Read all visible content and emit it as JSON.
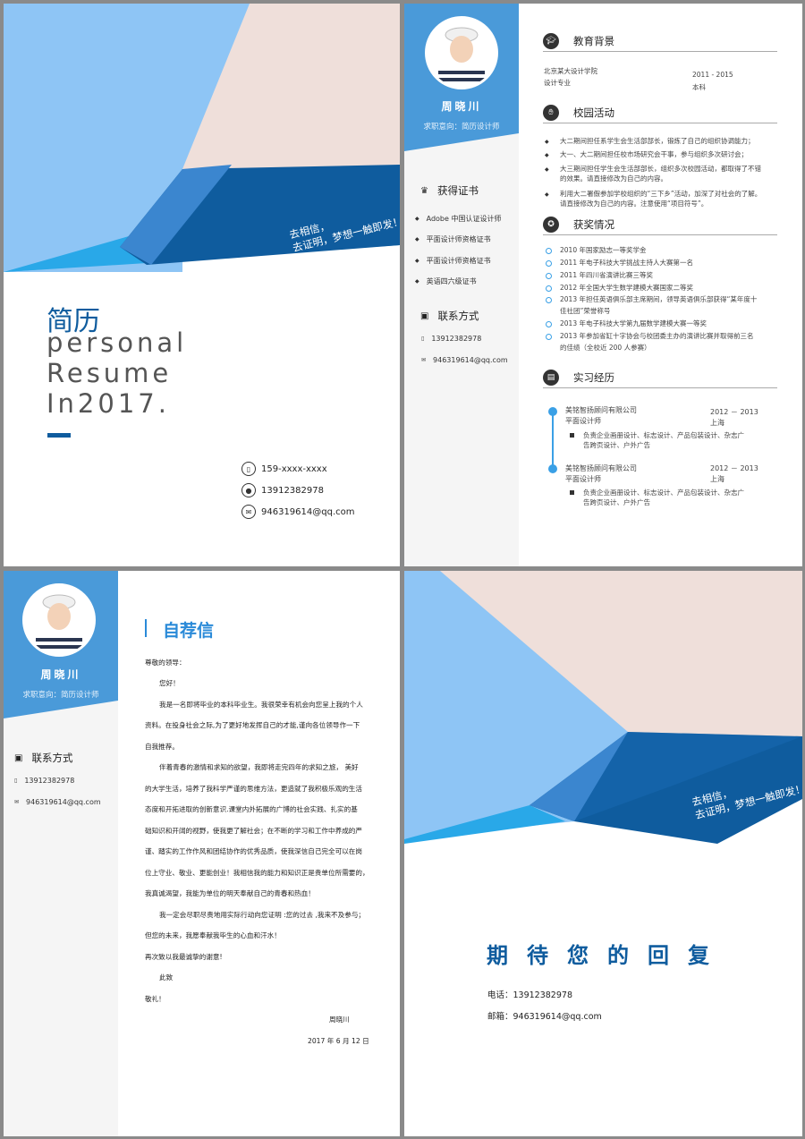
{
  "colors": {
    "navy": "#0f5c9e",
    "light_blue": "#8ec5f5",
    "mid_blue": "#4a9ad9",
    "pink": "#efdfda",
    "accent": "#2a8ad8"
  },
  "cover": {
    "slogan_line1": "去相信，",
    "slogan_line2": "去证明，梦想一触即发！",
    "title_cn": "简历",
    "title_en_1": "personal",
    "title_en_2": "Resume",
    "title_en_3": "In2017.",
    "contacts": [
      {
        "icon": "phone-icon",
        "text": "159-xxxx-xxxx"
      },
      {
        "icon": "qq-icon",
        "text": "13912382978"
      },
      {
        "icon": "mail-icon",
        "text": "946319614@qq.com"
      }
    ]
  },
  "profile": {
    "name": "周晓川",
    "intent": "求职意向：简历设计师"
  },
  "sidebar": {
    "cert_title": "获得证书",
    "certs": [
      "Adobe 中国认证设计师",
      "平面设计师资格证书",
      "平面设计师资格证书",
      "英语四六级证书"
    ],
    "contact_title": "联系方式",
    "phone": "13912382978",
    "email": "946319614@qq.com"
  },
  "education": {
    "title": "教育背景",
    "school": "北京某大设计学院",
    "major": "设计专业",
    "years": "2011 - 2015",
    "degree": "本科"
  },
  "campus": {
    "title": "校园活动",
    "items": [
      "大二期间担任系学生会生活部部长，锻炼了自己的组织协调能力；",
      "大一、大二期间担任校市场研究会干事，参与组织多次研讨会；",
      "大三期间担任学生会生活部部长，组织多次校园活动，都取得了不错",
      "的效果。请直接修改为自己的内容。",
      "利用大二署假参加学校组织的“三下乡”活动，加深了对社会的了解。",
      "请直接修改为自己的内容。注意使用“项目符号”。"
    ]
  },
  "awards": {
    "title": "获奖情况",
    "items": [
      "2010 年国家励志一等奖学金",
      "2011 年电子科技大学挑战主持人大赛第一名",
      "2011 年四川省演讲比赛三等奖",
      "2012 年全国大学生数学建模大赛国家二等奖",
      "2013 年担任英语俱乐部主席期间，领导英语俱乐部获得“某年度十",
      "佳社团”荣誉称号",
      "2013 年电子科技大学第九届数学建模大赛一等奖",
      "2013 年参加省缸十字协会与校团委主办的演讲比赛并取得前三名",
      "的佳绩（全校近 200 人参赛）"
    ]
  },
  "experience": {
    "title": "实习经历",
    "jobs": [
      {
        "company": "美铭智扬顾问有限公司",
        "role": "平面设计师",
        "years": "2012 － 2013",
        "city": "上海",
        "desc1": "负责企业画册设计、标志设计、产品包装设计、杂志广",
        "desc2": "告跨页设计、户外广告"
      },
      {
        "company": "美铭智扬顾问有限公司",
        "role": "平面设计师",
        "years": "2012 － 2013",
        "city": "上海",
        "desc1": "负责企业画册设计、标志设计、产品包装设计、杂志广",
        "desc2": "告跨页设计、户外广告"
      }
    ]
  },
  "letter": {
    "title": "自荐信",
    "greeting": "尊敬的领导：",
    "hello": "您好！",
    "lines": [
      "我是一名即将毕业的本科毕业生。我很荣幸有机会向您呈上我的个人",
      "资料。在投身社会之际,为了更好地发挥自己的才能,谨向各位领导作一下",
      "自我推荐。",
      "伴着青春的激情和求知的欲望，我即将走完四年的求知之旅， 美好",
      "的大学生活，培养了我科学严谨的思维方法，更造就了我积极乐观的生活",
      "态度和开拓进取的创新意识.课堂内外拓展的广博的社会实践、扎实的基",
      "础知识和开阔的视野，使我更了解社会；在不断的学习和工作中养成的严",
      "谨、踏实的工作作风和团结协作的优秀品质，使我深信自己完全可以在岗",
      "位上守业、敬业、更能创业！我相信我的能力和知识正是贵单位所需要的，",
      "我真诚渴望，我能为单位的明天奉献自己的青春和热血！",
      "我一定会尽职尽责地用实际行动向您证明 :您的过去 ,我来不及参与；",
      "但您的未来，我愿奉献我毕生的心血和汗水！",
      "再次致以我最诚挚的谢意!",
      "此致",
      "敬礼！"
    ],
    "signature": "周晓川",
    "date": "2017 年 6 月 12 日"
  },
  "back": {
    "slogan_line1": "去相信，",
    "slogan_line2": "去证明，梦想一触即发！",
    "thanks": "期待您的回复",
    "phone": "电话：13912382978",
    "email": "邮箱：946319614@qq.com"
  }
}
